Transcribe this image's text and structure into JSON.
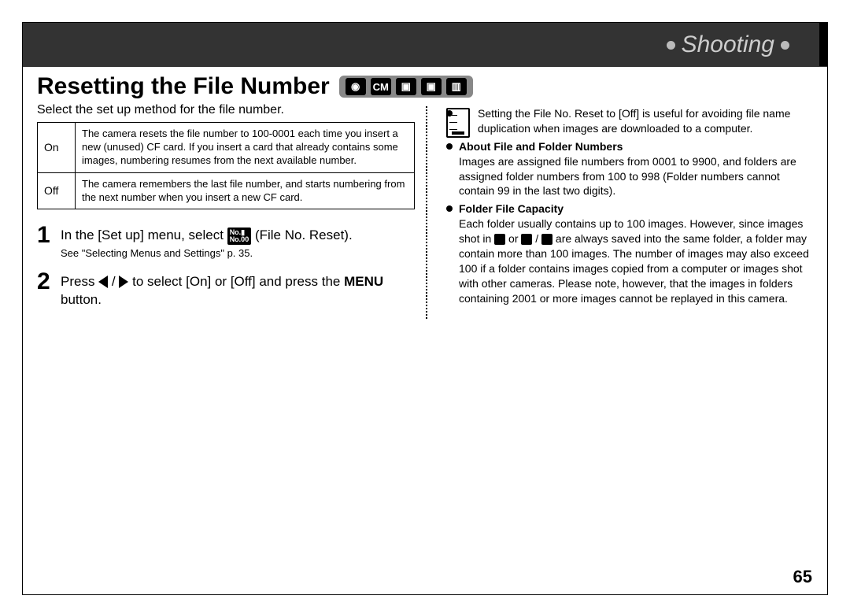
{
  "header": {
    "section": "Shooting"
  },
  "title": "Resetting the File Number",
  "mode_icons": [
    "●",
    "CM",
    "▣",
    "▣",
    "▣"
  ],
  "intro": "Select the set up method for the file number.",
  "table": {
    "rows": [
      {
        "label": "On",
        "desc": "The camera resets the file number to 100-0001 each time you insert a new (unused) CF card. If you insert a card that already contains some images, numbering resumes from the next available number."
      },
      {
        "label": "Off",
        "desc": "The camera remembers the last file number, and starts numbering from the next number when you insert a new CF card."
      }
    ]
  },
  "steps": [
    {
      "num": "1",
      "pre": "In the [Set up] menu, select ",
      "icon_label": "No.00",
      "post": " (File No. Reset).",
      "sub": "See \"Selecting Menus and Settings\" p. 35."
    },
    {
      "num": "2",
      "pre": "Press ",
      "mid": " to select [On] or [Off] and press the ",
      "menu": "MENU",
      "post": " button."
    }
  ],
  "notes": {
    "b1": "Setting the File No. Reset to [Off] is useful for avoiding file name duplication when images are downloaded to a computer.",
    "b2_head": "About File and Folder Numbers",
    "b2_body": "Images are assigned file numbers from 0001 to 9900, and folders are assigned folder numbers from 100 to 998 (Folder numbers cannot contain 99 in the last two digits).",
    "b3_head": "Folder File Capacity",
    "b3_body_a": "Each folder usually contains up to 100 images. However, since images shot in ",
    "b3_body_b": " or ",
    "b3_body_c": " / ",
    "b3_body_d": " are always saved into the same folder, a folder may contain more than 100 images. The number of images may also exceed 100 if a folder contains images copied from a computer or images shot with other cameras. Please note, however, that the images in folders containing 2001 or more images cannot be replayed in this camera."
  },
  "page": "65"
}
